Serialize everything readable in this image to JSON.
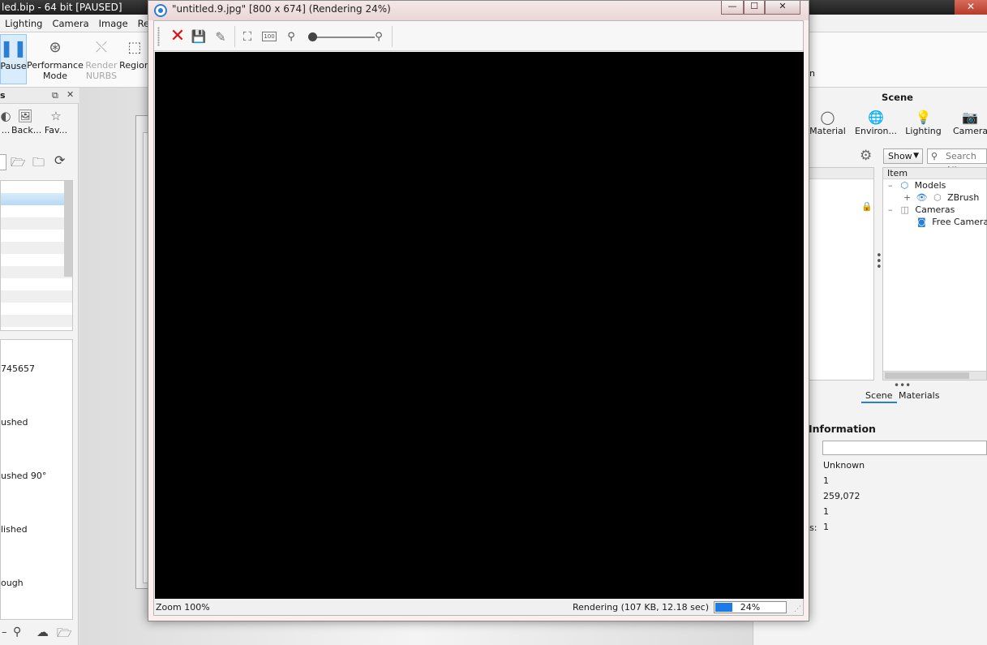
{
  "main_window": {
    "title_fragment": "led.bip  - 64 bit [PAUSED]",
    "close_glyph": "✕"
  },
  "menu": [
    "Lighting",
    "Camera",
    "Image",
    "Rende"
  ],
  "ribbon": {
    "pause": "Pause",
    "performance_line1": "Performance",
    "performance_line2": "Mode",
    "render_nurbs_line1": "Render",
    "render_nurbs_line2": "NURBS",
    "region": "Region",
    "cut_text": "n"
  },
  "left_panel": {
    "header_fragment": "s",
    "tabs": [
      "...",
      "Back...",
      "Fav..."
    ],
    "properties": [
      "745657",
      "ushed",
      "ushed 90°",
      "lished",
      "ough"
    ]
  },
  "render_window": {
    "title": "\"untitled.9.jpg\" [800 x 674] (Rendering 24%)",
    "minimize": "—",
    "maximize": "☐",
    "close": "✕",
    "toolbar": {
      "stop_glyph": "✕",
      "save_glyph": "💾",
      "edit_glyph": "✎",
      "fit_glyph": "⛶",
      "actual_size_label": "100",
      "zoom_out_glyph": "⚲",
      "zoom_in_glyph": "⚲"
    },
    "zoom_level": 0.07,
    "status": {
      "zoom": "Zoom 100%",
      "rendering": "Rendering (107 KB, 12.18 sec)",
      "progress_label": "24%",
      "progress_value": 0.24
    }
  },
  "scene_panel": {
    "title": "Scene",
    "tabs": [
      "Material",
      "Environ...",
      "Lighting",
      "Camera"
    ],
    "show_label": "Show",
    "search_placeholder": "Search All",
    "tree_header": "Item",
    "tree": {
      "models": "Models",
      "zbrush": "ZBrush",
      "cameras": "Cameras",
      "free_camera": "Free Camera"
    },
    "subtabs": [
      "Scene",
      "Materials"
    ],
    "information_title": "Information",
    "info_values": [
      "Unknown",
      "1",
      "259,072",
      "1",
      "1"
    ],
    "info_label_fragment": "s:"
  }
}
